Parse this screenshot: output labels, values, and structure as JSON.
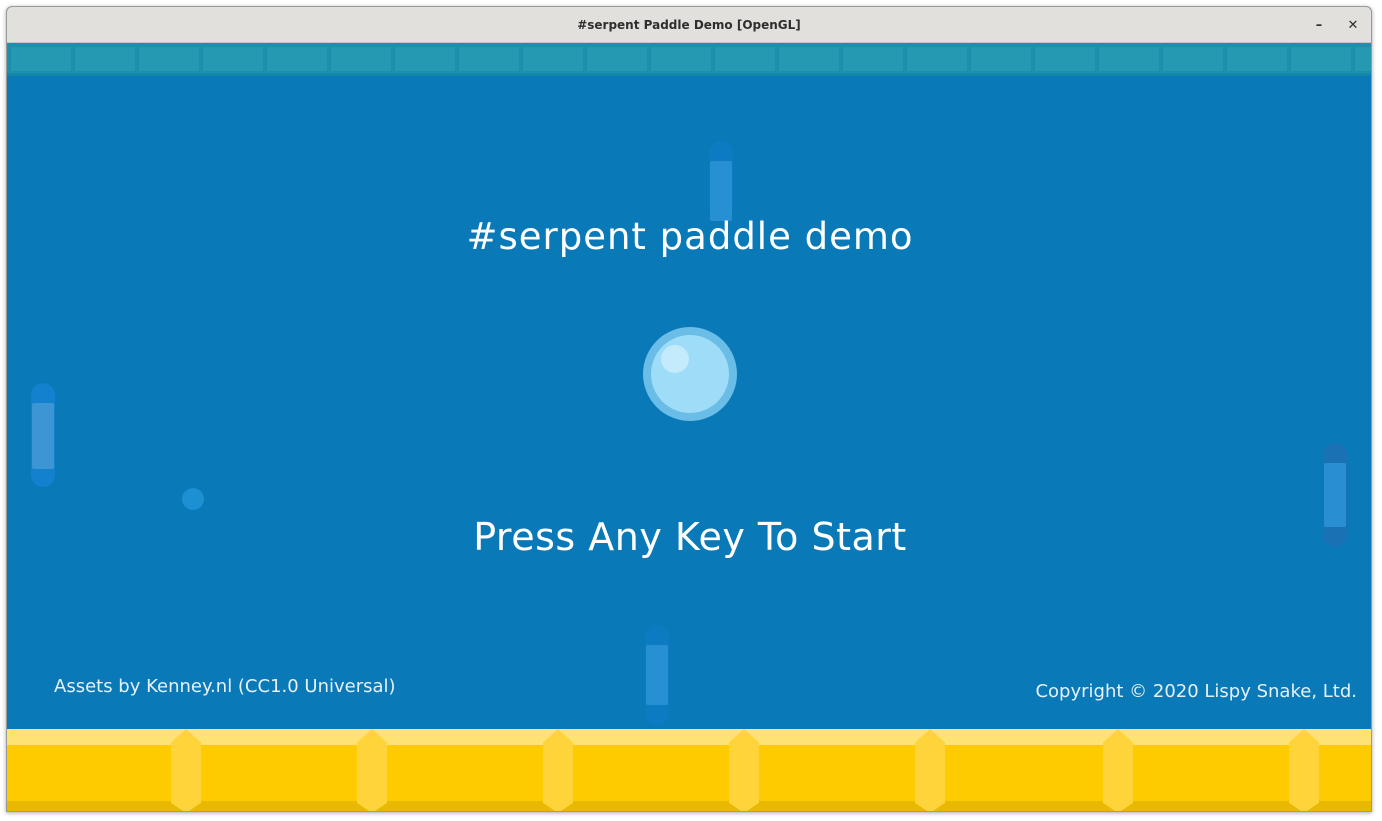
{
  "window": {
    "title": "#serpent Paddle Demo [OpenGL]",
    "minimize_label": "–",
    "close_label": "✕"
  },
  "game": {
    "title": "#serpent paddle demo",
    "prompt": "Press Any Key To Start",
    "assets_credit": "Assets by Kenney.nl (CC1.0 Universal)",
    "copyright": "Copyright © 2020 Lispy Snake, Ltd."
  },
  "colors": {
    "background": "#0a79b8",
    "top_wall": "#1b92ad",
    "floor": "#fecb00",
    "ball": "#9fdcf8",
    "text": "#ffffff"
  }
}
